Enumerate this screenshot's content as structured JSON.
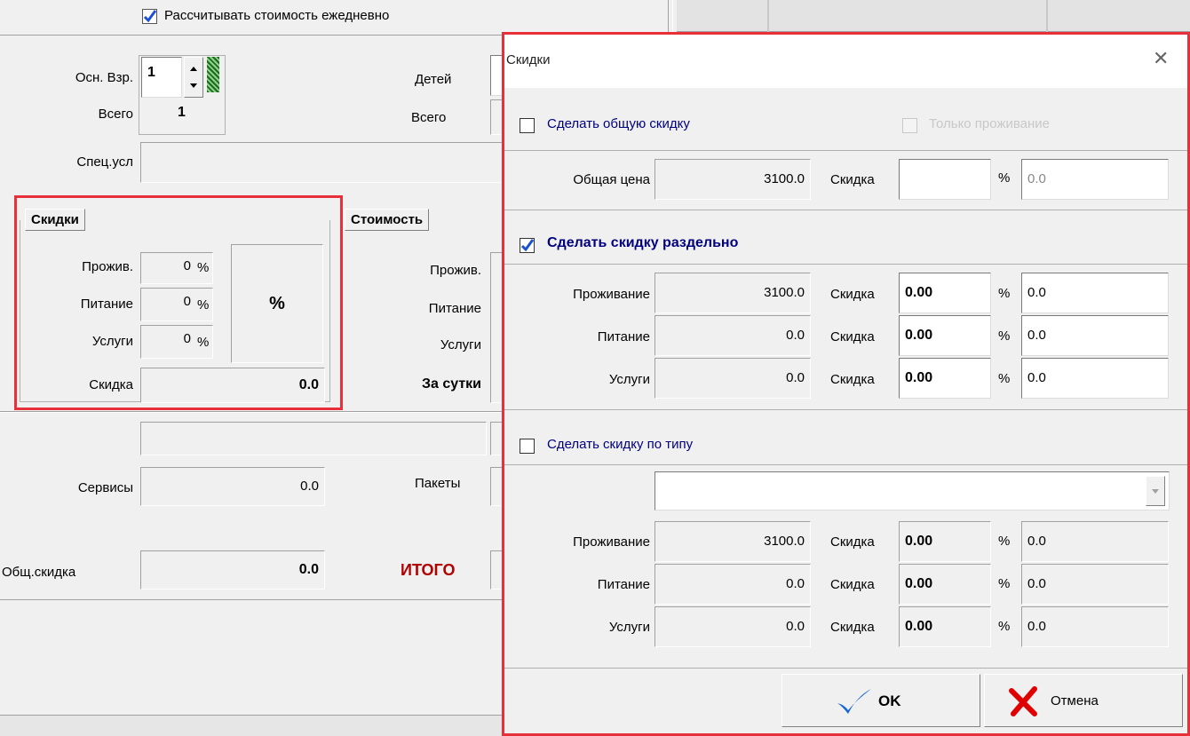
{
  "background": {
    "daily_calc_checkbox": {
      "label": "Рассчитывать стоимость ежедневно",
      "checked": true
    },
    "adults": {
      "label": "Осн. Взр.",
      "value": "1",
      "total_label": "Всего",
      "total_value": "1"
    },
    "children": {
      "label": "Детей",
      "total_label": "Всего"
    },
    "special_conditions": {
      "label": "Спец.усл"
    },
    "discounts_panel": {
      "title": "Скидки",
      "rows": [
        {
          "label": "Прожив.",
          "value": "0",
          "unit": "%"
        },
        {
          "label": "Питание",
          "value": "0",
          "unit": "%"
        },
        {
          "label": "Услуги",
          "value": "0",
          "unit": "%"
        }
      ],
      "percent_button": "%",
      "discount_label": "Скидка",
      "discount_value": "0.0"
    },
    "cost_panel": {
      "title": "Стоимость",
      "rows": [
        "Прожив.",
        "Питание",
        "Услуги"
      ],
      "per_day_label": "За сутки"
    },
    "services": {
      "label": "Сервисы",
      "value": "0.0"
    },
    "packages": {
      "label": "Пакеты"
    },
    "total_discount": {
      "label": "Общ.скидка",
      "value": "0.0"
    },
    "total": {
      "label": "ИТОГО"
    }
  },
  "dialog": {
    "title": "Скидки",
    "close_symbol": "✕",
    "general": {
      "checkbox_label": "Сделать общую скидку",
      "checked": false,
      "accommodation_only_label": "Только проживание",
      "price_label": "Общая цена",
      "price_value": "3100.0",
      "discount_label": "Скидка",
      "discount_value": "",
      "percent_sign": "%",
      "percent_value": "0.0"
    },
    "separate": {
      "checkbox_label": "Сделать скидку раздельно",
      "checked": true,
      "rows": [
        {
          "label": "Проживание",
          "price": "3100.0",
          "discount_label": "Скидка",
          "discount": "0.00",
          "percent_sign": "%",
          "percent": "0.0"
        },
        {
          "label": "Питание",
          "price": "0.0",
          "discount_label": "Скидка",
          "discount": "0.00",
          "percent_sign": "%",
          "percent": "0.0"
        },
        {
          "label": "Услуги",
          "price": "0.0",
          "discount_label": "Скидка",
          "discount": "0.00",
          "percent_sign": "%",
          "percent": "0.0"
        }
      ]
    },
    "by_type": {
      "checkbox_label": "Сделать скидку по типу",
      "checked": false,
      "selected_type": "",
      "rows": [
        {
          "label": "Проживание",
          "price": "3100.0",
          "discount_label": "Скидка",
          "discount": "0.00",
          "percent_sign": "%",
          "percent": "0.0"
        },
        {
          "label": "Питание",
          "price": "0.0",
          "discount_label": "Скидка",
          "discount": "0.00",
          "percent_sign": "%",
          "percent": "0.0"
        },
        {
          "label": "Услуги",
          "price": "0.0",
          "discount_label": "Скидка",
          "discount": "0.00",
          "percent_sign": "%",
          "percent": "0.0"
        }
      ]
    },
    "buttons": {
      "ok": "OK",
      "cancel": "Отмена"
    }
  },
  "colors": {
    "highlight_border": "#e8303a",
    "checkmark": "#1a4fd6",
    "link_label": "#000080",
    "total_label": "#b00000",
    "ok_icon": "#1466d6",
    "cancel_icon": "#e00000"
  }
}
